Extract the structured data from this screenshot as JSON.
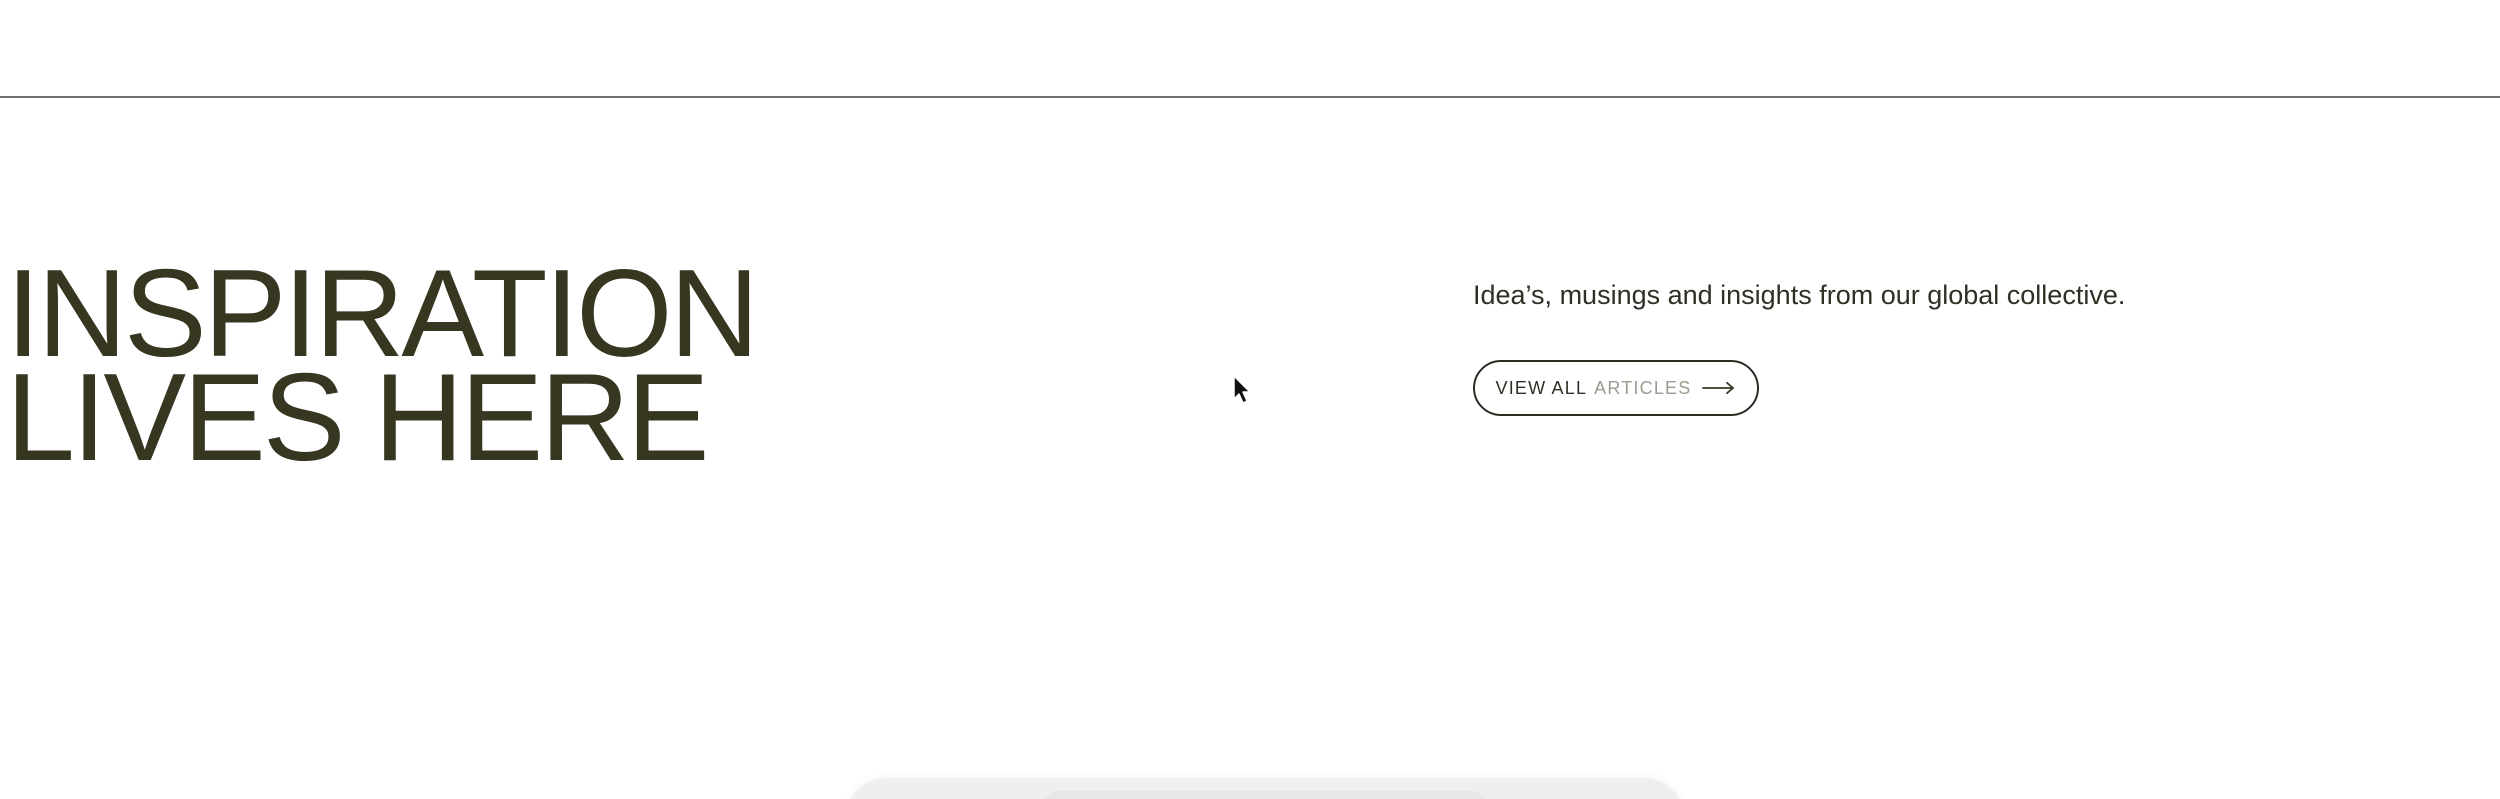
{
  "hero": {
    "title_line_1": "INSPIRATION",
    "title_line_2": "LIVES HERE",
    "description": "Idea’s, musings and insights from our global collective."
  },
  "cta": {
    "label_primary": "VIEW ALL",
    "label_secondary": "ARTICLES",
    "icon": "arrow-right-icon"
  },
  "colors": {
    "title": "#363621",
    "body_text": "#2f2f25",
    "muted_text": "#9b9b90",
    "rule": "#6f6f6f",
    "background": "#ffffff",
    "shelf": "#efefef"
  },
  "cursor": {
    "icon": "mouse-pointer-icon"
  }
}
